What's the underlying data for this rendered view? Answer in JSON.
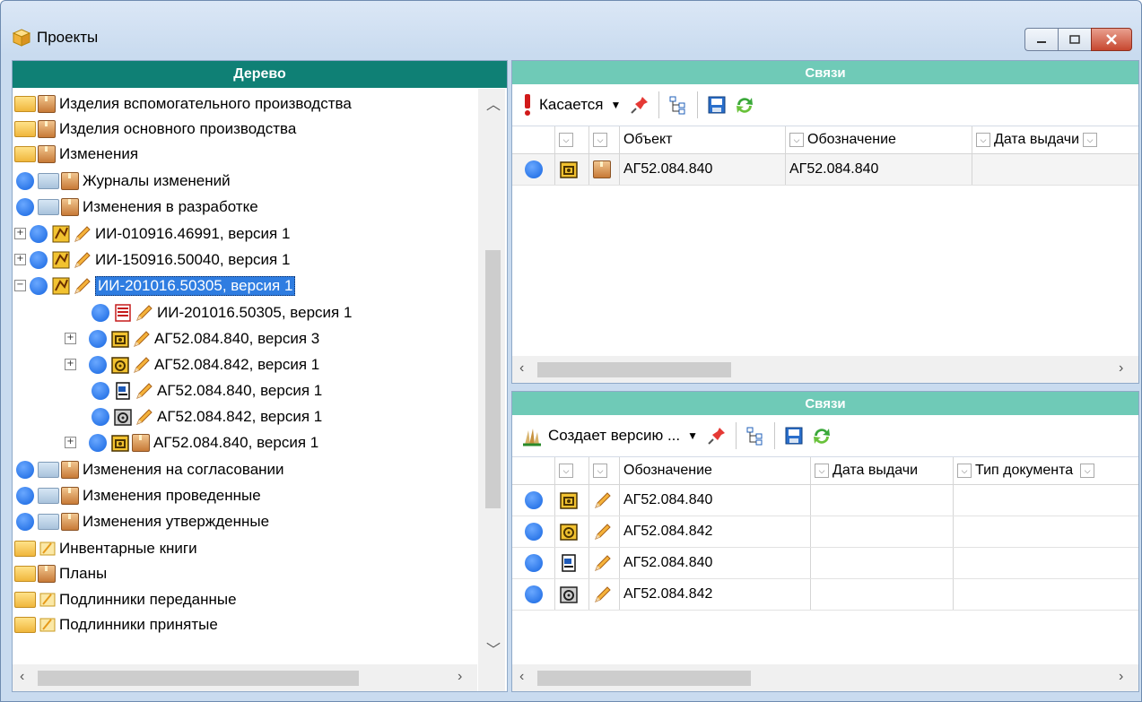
{
  "window": {
    "title": "Проекты"
  },
  "left_panel": {
    "header": "Дерево",
    "items": [
      {
        "label": "Изделия вспомогательного производства"
      },
      {
        "label": "Изделия основного производства"
      },
      {
        "label": "Изменения"
      },
      {
        "label": "Журналы изменений"
      },
      {
        "label": "Изменения в разработке"
      },
      {
        "label": "ИИ-010916.46991, версия 1"
      },
      {
        "label": "ИИ-150916.50040, версия 1"
      },
      {
        "label": "ИИ-201016.50305, версия 1"
      },
      {
        "label": "ИИ-201016.50305, версия 1"
      },
      {
        "label": "АГ52.084.840, версия 3"
      },
      {
        "label": "АГ52.084.842, версия 1"
      },
      {
        "label": "АГ52.084.840, версия 1"
      },
      {
        "label": "АГ52.084.842, версия 1"
      },
      {
        "label": "АГ52.084.840, версия 1"
      },
      {
        "label": "Изменения на согласовании"
      },
      {
        "label": "Изменения проведенные"
      },
      {
        "label": "Изменения утвержденные"
      },
      {
        "label": "Инвентарные книги"
      },
      {
        "label": "Планы"
      },
      {
        "label": "Подлинники переданные"
      },
      {
        "label": "Подлинники принятые"
      }
    ]
  },
  "top_panel": {
    "header": "Связи",
    "toolbar_label": "Касается",
    "columns": [
      "Объект",
      "Обозначение",
      "Дата выдачи"
    ],
    "rows": [
      {
        "object": "АГ52.084.840",
        "designation": "АГ52.084.840"
      }
    ]
  },
  "bottom_panel": {
    "header": "Связи",
    "toolbar_label": "Создает версию ...",
    "columns": [
      "Обозначение",
      "Дата выдачи",
      "Тип документа"
    ],
    "rows": [
      {
        "designation": "АГ52.084.840"
      },
      {
        "designation": "АГ52.084.842"
      },
      {
        "designation": "АГ52.084.840"
      },
      {
        "designation": "АГ52.084.842"
      }
    ]
  },
  "colors": {
    "tree_header": "#0f8075",
    "panel_header": "#6fcab7",
    "selection": "#2f7de1",
    "status_dot": "#1565e0"
  },
  "icons": [
    "project-cube-icon",
    "folder-icon",
    "box-icon",
    "pencil-icon",
    "status-dot-icon",
    "pin-icon",
    "refresh-icon",
    "tree-icon",
    "save-icon"
  ]
}
